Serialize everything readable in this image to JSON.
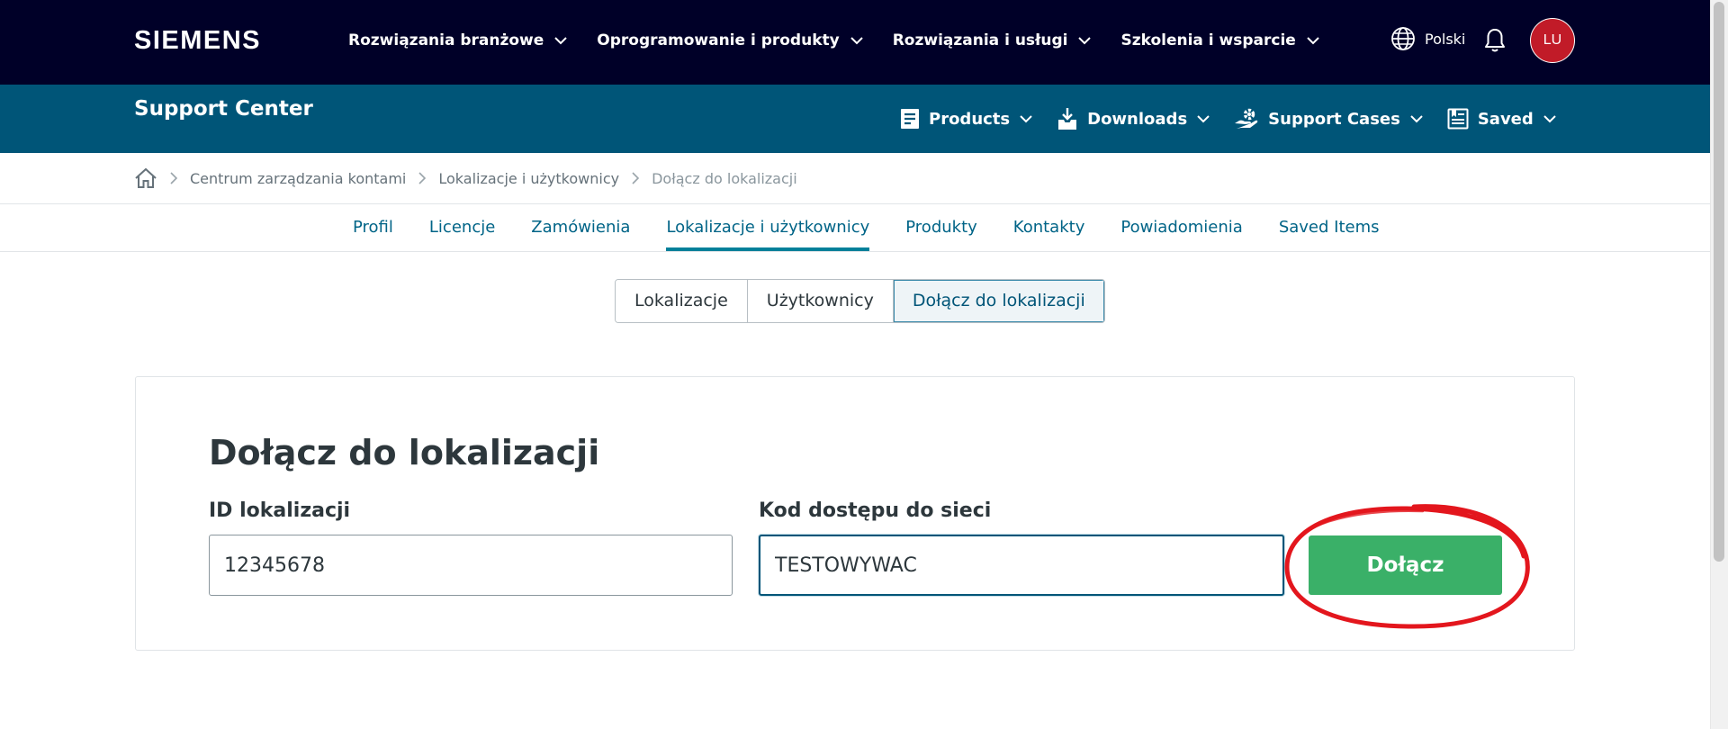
{
  "header": {
    "logo": "SIEMENS",
    "nav": [
      {
        "label": "Rozwiązania branżowe"
      },
      {
        "label": "Oprogramowanie i produkty"
      },
      {
        "label": "Rozwiązania i usługi"
      },
      {
        "label": "Szkolenia i wsparcie"
      }
    ],
    "language": "Polski",
    "avatar_initials": "LU"
  },
  "support_bar": {
    "title": "Support Center",
    "nav": [
      {
        "label": "Products",
        "icon": "list-document-icon"
      },
      {
        "label": "Downloads",
        "icon": "download-tray-icon"
      },
      {
        "label": "Support Cases",
        "icon": "hand-gear-icon"
      },
      {
        "label": "Saved",
        "icon": "saved-document-icon"
      }
    ]
  },
  "breadcrumb": {
    "items": [
      "Centrum zarządzania kontami",
      "Lokalizacje i użytkownicy"
    ],
    "current": "Dołącz do lokalizacji"
  },
  "account_tabs": [
    {
      "label": "Profil"
    },
    {
      "label": "Licencje"
    },
    {
      "label": "Zamówienia"
    },
    {
      "label": "Lokalizacje i użytkownicy",
      "active": true
    },
    {
      "label": "Produkty"
    },
    {
      "label": "Kontakty"
    },
    {
      "label": "Powiadomienia"
    },
    {
      "label": "Saved Items"
    }
  ],
  "segments": [
    {
      "label": "Lokalizacje"
    },
    {
      "label": "Użytkownicy"
    },
    {
      "label": "Dołącz do lokalizacji",
      "active": true
    }
  ],
  "form": {
    "title": "Dołącz do lokalizacji",
    "location_id_label": "ID lokalizacji",
    "location_id_value": "12345678",
    "access_code_label": "Kod dostępu do sieci",
    "access_code_value": "TESTOWYWAC",
    "submit_label": "Dołącz"
  },
  "colors": {
    "top_bar": "#000028",
    "support_bar": "#005578",
    "accent": "#00809a",
    "link": "#006487",
    "submit": "#3ab068",
    "avatar": "#c11b28",
    "annotation": "#e3161d"
  }
}
